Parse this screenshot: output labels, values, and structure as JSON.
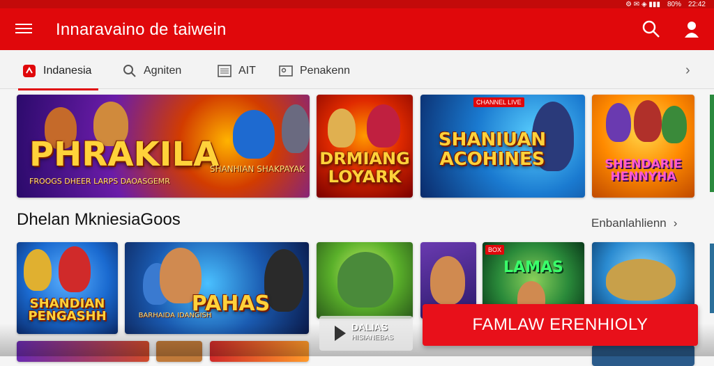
{
  "statusbar": {
    "icons": "⚙ ✉ ◈ ▮▮▮",
    "battery": "80%",
    "time": "22:42"
  },
  "appbar": {
    "title": "Innaravaino de taiwein",
    "menu_icon": "menu-icon",
    "search_icon": "search-icon",
    "user_icon": "user-icon"
  },
  "tabs": [
    {
      "label": "Indanesia",
      "icon": "app-icon",
      "active": true
    },
    {
      "label": "Agniten",
      "icon": "search-icon"
    },
    {
      "label": "AIT",
      "icon": "list-icon"
    },
    {
      "label": "Penakenn",
      "icon": "image-icon"
    }
  ],
  "featured": [
    {
      "title": "PHRAKILA",
      "sub": "FROOGS DHEER  LARPS DAOASGEMR",
      "sub2": "SHANHIAN SHAKPAYAK"
    },
    {
      "title": "DRMIANG",
      "title2": "LOYARK"
    },
    {
      "badge": "CHANNEL LIVE",
      "title": "SHANIUAN",
      "title2": "ACOHINES"
    },
    {
      "title": "SHENDARIE",
      "title2": "HENNYHA"
    }
  ],
  "section": {
    "title": "Dhelan MkniesiaGoos",
    "more_label": "Enbanlahlienn"
  },
  "games": [
    {
      "title": "SHANDIAN",
      "title2": "PENGASHH"
    },
    {
      "title": "PAHAS",
      "sub": "BARHAIDA IDANGISH"
    },
    {
      "title": ""
    },
    {
      "badge": ""
    },
    {
      "badge": "BOX",
      "title": "LAMAS"
    },
    {
      "title": ""
    }
  ],
  "play": {
    "label": "DALIAS",
    "sub": "HISIANEBAS"
  },
  "cta": {
    "label": "FAMLAW ERENHIOLY"
  },
  "colors": {
    "brand": "#e0080b",
    "cta": "#e8101a"
  }
}
